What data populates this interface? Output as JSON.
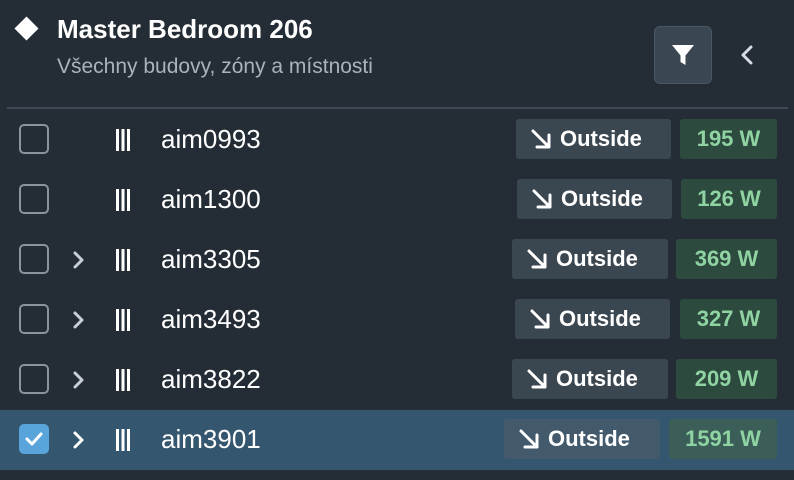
{
  "header": {
    "title": "Master Bedroom 206",
    "subtitle": "Všechny budovy, zóny a místnosti",
    "icons": {
      "title": "diamond-icon",
      "filter": "filter-icon",
      "collapse": "chevron-left-icon"
    }
  },
  "rows": [
    {
      "name": "aim0993",
      "direction": "Outside",
      "power": "195 W",
      "checked": false,
      "expandable": false
    },
    {
      "name": "aim1300",
      "direction": "Outside",
      "power": "126 W",
      "checked": false,
      "expandable": false
    },
    {
      "name": "aim3305",
      "direction": "Outside",
      "power": "369 W",
      "checked": false,
      "expandable": true
    },
    {
      "name": "aim3493",
      "direction": "Outside",
      "power": "327 W",
      "checked": false,
      "expandable": true
    },
    {
      "name": "aim3822",
      "direction": "Outside",
      "power": "209 W",
      "checked": false,
      "expandable": true
    },
    {
      "name": "aim3901",
      "direction": "Outside",
      "power": "1591 W",
      "checked": true,
      "expandable": true
    }
  ],
  "colors": {
    "background": "#242d35",
    "selected_row": "#34566f",
    "power_text": "#8fd3a3",
    "checkbox_checked": "#5aa4dc"
  }
}
